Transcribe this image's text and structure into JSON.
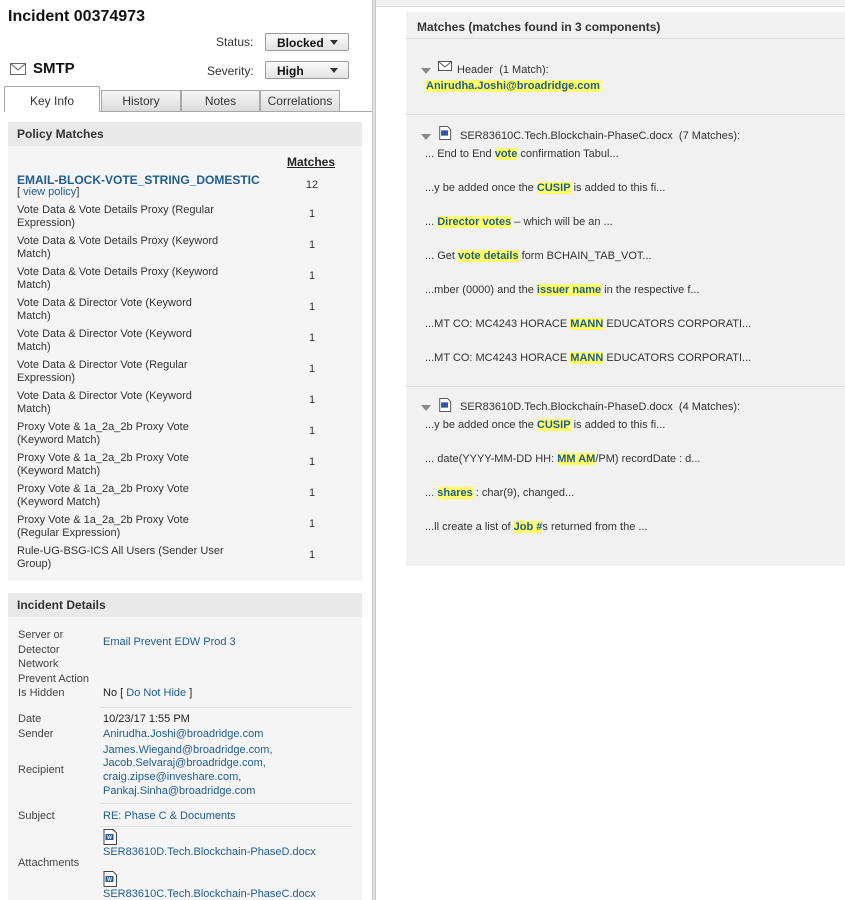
{
  "incident": {
    "title": "Incident 00374973",
    "channel": "SMTP",
    "status_label": "Status:",
    "status_value": "Blocked",
    "severity_label": "Severity:",
    "severity_value": "High"
  },
  "tabs": [
    {
      "label": "Key Info",
      "active": true
    },
    {
      "label": "History",
      "active": false
    },
    {
      "label": "Notes",
      "active": false
    },
    {
      "label": "Correlations",
      "active": false
    }
  ],
  "policy_matches": {
    "heading": "Policy Matches",
    "matches_col": "Matches",
    "policy_name": "EMAIL-BLOCK-VOTE_STRING_DOMESTIC",
    "view_policy_open": "[ ",
    "view_policy_link": "view policy",
    "view_policy_close": "]",
    "policy_total": "12",
    "rules": [
      {
        "name": "Vote Data & Vote Details Proxy (Regular Expression)",
        "count": "1"
      },
      {
        "name": "Vote Data & Vote Details Proxy (Keyword Match)",
        "count": "1"
      },
      {
        "name": "Vote Data & Vote Details Proxy (Keyword Match)",
        "count": "1"
      },
      {
        "name": "Vote Data & Director Vote (Keyword Match)",
        "count": "1"
      },
      {
        "name": "Vote Data & Director Vote (Keyword Match)",
        "count": "1"
      },
      {
        "name": "Vote Data & Director Vote (Regular Expression)",
        "count": "1"
      },
      {
        "name": "Vote Data & Director Vote (Keyword Match)",
        "count": "1"
      },
      {
        "name": "Proxy Vote & 1a_2a_2b Proxy Vote (Keyword Match)",
        "count": "1"
      },
      {
        "name": "Proxy Vote & 1a_2a_2b Proxy Vote (Keyword Match)",
        "count": "1"
      },
      {
        "name": "Proxy Vote & 1a_2a_2b Proxy Vote (Keyword Match)",
        "count": "1"
      },
      {
        "name": "Proxy Vote & 1a_2a_2b Proxy Vote (Regular Expression)",
        "count": "1"
      },
      {
        "name": "Rule-UG-BSG-ICS All Users (Sender User Group)",
        "count": "1"
      }
    ]
  },
  "incident_details": {
    "heading": "Incident Details",
    "server_label": "Server or Detector",
    "server_value": "Email Prevent EDW Prod 3",
    "prevent_label": "Network Prevent Action",
    "hidden_label": "Is Hidden",
    "hidden_value": "No [",
    "hidden_link": "Do Not Hide",
    "hidden_close": "]",
    "date_label": "Date",
    "date_value": "10/23/17 1:55 PM",
    "sender_label": "Sender",
    "sender_value": "Anirudha.Joshi@broadridge.com",
    "recipient_label": "Recipient",
    "recipients": [
      "James.Wiegand@broadridge.com,",
      "Jacob.Selvaraj@broadridge.com,",
      "craig.zipse@inveshare.com,",
      "Pankaj.Sinha@broadridge.com"
    ],
    "subject_label": "Subject",
    "subject_value": "RE: Phase C & Documents",
    "attachments_label": "Attachments",
    "attachments": [
      "SER83610D.Tech.Blockchain-PhaseD.docx",
      "SER83610C.Tech.Blockchain-PhaseC.docx"
    ]
  },
  "matches_panel": {
    "title": "Matches (matches found in 3 components)",
    "header_component": {
      "name": "Header",
      "count": "(1 Match):",
      "match": "Anirudha.Joshi@broadridge.com"
    },
    "file_c": {
      "name": "SER83610C.Tech.Blockchain-PhaseC.docx",
      "count": "(7 Matches):",
      "snippets": [
        {
          "pre": "... End to End ",
          "hit": "vote",
          "post": " confirmation Tabul..."
        },
        {
          "pre": "...y be added once the ",
          "hit": "CUSIP",
          "post": " is added to this fi..."
        },
        {
          "pre": "... ",
          "hit": "Director votes",
          "post": " – which will be an ..."
        },
        {
          "pre": "... Get ",
          "hit": "vote details",
          "post": " form BCHAIN_TAB_VOT..."
        },
        {
          "pre": "...mber (0000) and the ",
          "hit": "issuer name",
          "post": " in the respective f..."
        },
        {
          "pre": "...MT CO: MC4243 HORACE ",
          "hit": "MANN",
          "post": " EDUCATORS CORPORATI..."
        },
        {
          "pre": "...MT CO: MC4243 HORACE ",
          "hit": "MANN",
          "post": " EDUCATORS CORPORATI..."
        }
      ]
    },
    "file_d": {
      "name": "SER83610D.Tech.Blockchain-PhaseD.docx",
      "count": "(4 Matches):",
      "snippets": [
        {
          "pre": "...y be added once the ",
          "hit": "CUSIP",
          "post": " is added to this fi..."
        },
        {
          "pre": "... date(YYYY-MM-DD HH: ",
          "hit": "MM AM",
          "post": "/PM) recordDate : d..."
        },
        {
          "pre": "... ",
          "hit": "shares",
          "post": " : char(9), changed..."
        },
        {
          "pre": "...ll create a list of ",
          "hit": "Job #",
          "post": "s returned from the ..."
        }
      ]
    }
  }
}
